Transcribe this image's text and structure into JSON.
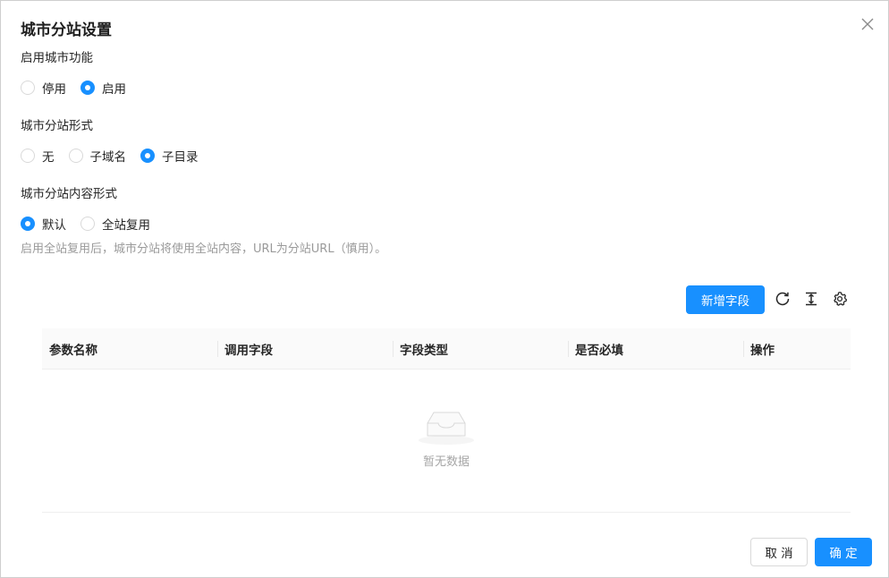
{
  "dialog": {
    "title": "城市分站设置",
    "close_icon": "close-icon"
  },
  "enable_section": {
    "label": "启用城市功能",
    "options": [
      {
        "label": "停用",
        "checked": false
      },
      {
        "label": "启用",
        "checked": true
      }
    ]
  },
  "form_section": {
    "label": "城市分站形式",
    "options": [
      {
        "label": "无",
        "checked": false
      },
      {
        "label": "子域名",
        "checked": false
      },
      {
        "label": "子目录",
        "checked": true
      }
    ]
  },
  "content_section": {
    "label": "城市分站内容形式",
    "options": [
      {
        "label": "默认",
        "checked": true
      },
      {
        "label": "全站复用",
        "checked": false
      }
    ],
    "hint": "启用全站复用后，城市分站将使用全站内容，URL为分站URL（慎用）。"
  },
  "toolbar": {
    "add_field_label": "新增字段",
    "icons": [
      "refresh-icon",
      "column-height-icon",
      "settings-icon"
    ]
  },
  "table": {
    "columns": [
      "参数名称",
      "调用字段",
      "字段类型",
      "是否必填",
      "操作"
    ],
    "rows": [],
    "empty_text": "暂无数据"
  },
  "footer": {
    "cancel_label": "取 消",
    "confirm_label": "确 定"
  },
  "colors": {
    "primary": "#1890ff",
    "border": "#d9d9d9",
    "hint": "#9a9a9a",
    "header_bg": "#fafafa"
  }
}
